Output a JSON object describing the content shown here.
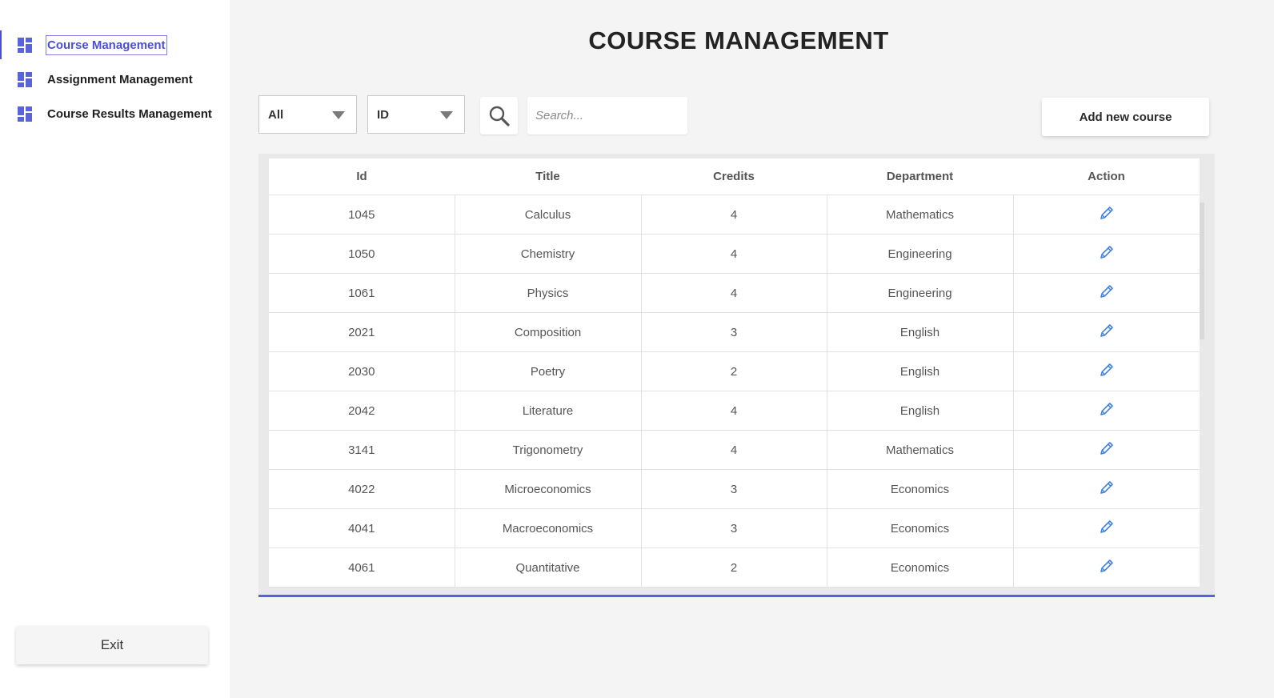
{
  "sidebar": {
    "items": [
      {
        "label": "Course Management",
        "icon": "grid-icon",
        "active": true
      },
      {
        "label": "Assignment Management",
        "icon": "grid-icon",
        "active": false
      },
      {
        "label": "Course Results Management",
        "icon": "grid-icon",
        "active": false
      }
    ],
    "exit_label": "Exit"
  },
  "main": {
    "title": "COURSE MANAGEMENT",
    "filters": {
      "category_select": "All",
      "field_select": "ID"
    },
    "search": {
      "placeholder": "Search...",
      "icon": "magnifier-icon"
    },
    "add_button_label": "Add new course"
  },
  "table": {
    "columns": [
      "Id",
      "Title",
      "Credits",
      "Department",
      "Action"
    ],
    "rows": [
      {
        "id": "1045",
        "title": "Calculus",
        "credits": "4",
        "department": "Mathematics"
      },
      {
        "id": "1050",
        "title": "Chemistry",
        "credits": "4",
        "department": "Engineering"
      },
      {
        "id": "1061",
        "title": "Physics",
        "credits": "4",
        "department": "Engineering"
      },
      {
        "id": "2021",
        "title": "Composition",
        "credits": "3",
        "department": "English"
      },
      {
        "id": "2030",
        "title": "Poetry",
        "credits": "2",
        "department": "English"
      },
      {
        "id": "2042",
        "title": "Literature",
        "credits": "4",
        "department": "English"
      },
      {
        "id": "3141",
        "title": "Trigonometry",
        "credits": "4",
        "department": "Mathematics"
      },
      {
        "id": "4022",
        "title": "Microeconomics",
        "credits": "3",
        "department": "Economics"
      },
      {
        "id": "4041",
        "title": "Macroeconomics",
        "credits": "3",
        "department": "Economics"
      },
      {
        "id": "4061",
        "title": "Quantitative",
        "credits": "2",
        "department": "Economics"
      }
    ],
    "action_icon": "pencil-edit-icon"
  },
  "colors": {
    "accent": "#4b4fd1",
    "icon_blue": "#5b63dc",
    "edit_blue": "#3d7fe0",
    "background": "#f4f4f4"
  }
}
